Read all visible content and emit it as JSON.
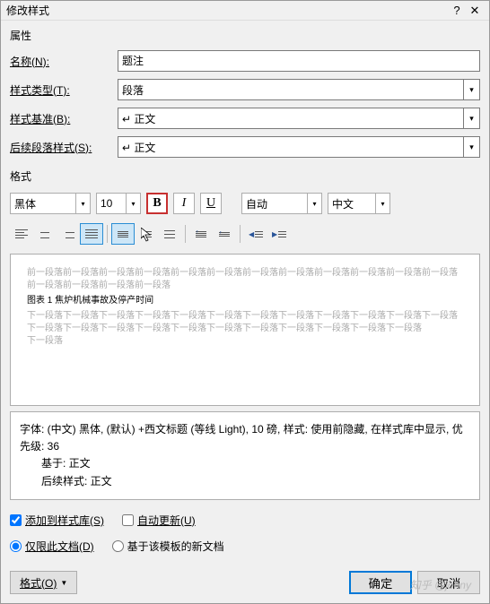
{
  "title": "修改样式",
  "section_properties": "属性",
  "section_format": "格式",
  "labels": {
    "name": "名称(N):",
    "type": "样式类型(T):",
    "based": "样式基准(B):",
    "next": "后续段落样式(S):"
  },
  "values": {
    "name": "题注",
    "type": "段落",
    "based": "↵ 正文",
    "next": "↵ 正文"
  },
  "font_toolbar": {
    "font": "黑体",
    "size": "10",
    "bold": "B",
    "italic": "I",
    "underline": "U",
    "color": "自动",
    "lang": "中文"
  },
  "preview": {
    "before": "前一段落前一段落前一段落前一段落前一段落前一段落前一段落前一段落前一段落前一段落前一段落前一段落前一段落前一段落前一段落前一段落",
    "caption": "图表 1 焦炉机械事故及停产时间",
    "after1": "下一段落下一段落下一段落下一段落下一段落下一段落下一段落下一段落下一段落下一段落下一段落下一段落下一段落下一段落下一段落下一段落下一段落下一段落下一段落下一段落下一段落下一段落下一段落",
    "after2": "下一段落"
  },
  "description": {
    "line1": "字体: (中文) 黑体, (默认) +西文标题 (等线 Light), 10 磅, 样式: 使用前隐藏, 在样式库中显示, 优先级: 36",
    "line2": "基于: 正文",
    "line3": "后续样式: 正文"
  },
  "checks": {
    "add_to_lib": "添加到样式库(S)",
    "auto_update": "自动更新(U)"
  },
  "radios": {
    "this_doc": "仅限此文档(D)",
    "template": "基于该模板的新文档"
  },
  "buttons": {
    "format": "格式(O)",
    "ok": "确定",
    "cancel": "取消"
  },
  "watermark": "知乎 @johny"
}
